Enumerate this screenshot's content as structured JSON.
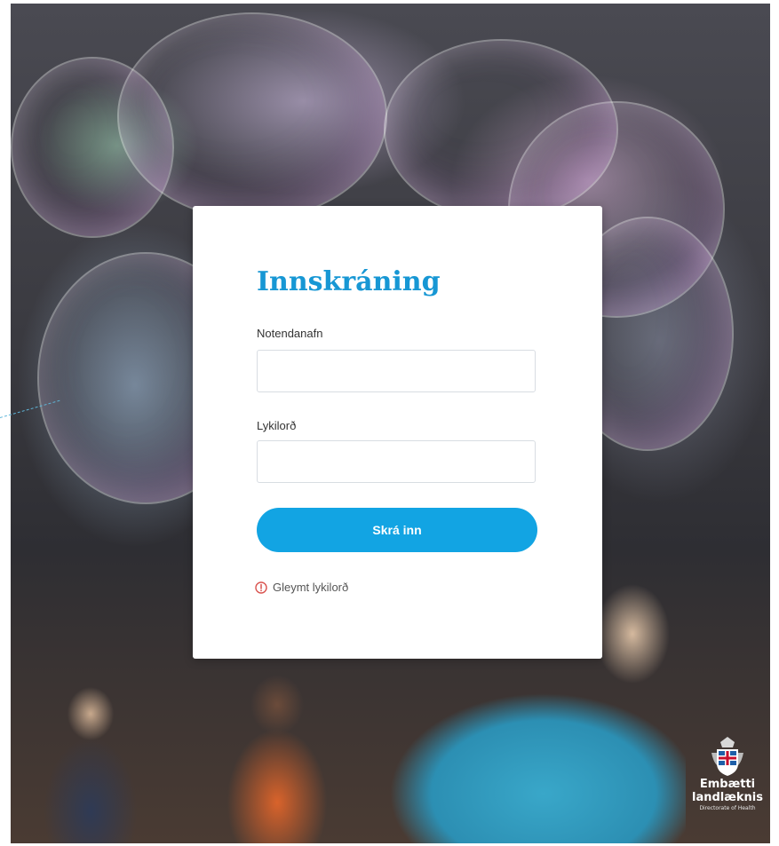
{
  "login": {
    "title": "Innskráning",
    "username_label": "Notendanafn",
    "username_value": "",
    "password_label": "Lykilorð",
    "password_value": "",
    "submit_label": "Skrá inn",
    "forgot_label": "Gleymt lykilorð"
  },
  "logo": {
    "line1": "Embætti",
    "line2": "landlæknis",
    "line3": "Directorate of Health"
  },
  "colors": {
    "accent": "#1797d4",
    "button": "#12a4e3",
    "forgot_icon": "#d9534f"
  },
  "icons": {
    "forgot": "lock-alert-icon",
    "logo": "coat-of-arms-icon"
  }
}
